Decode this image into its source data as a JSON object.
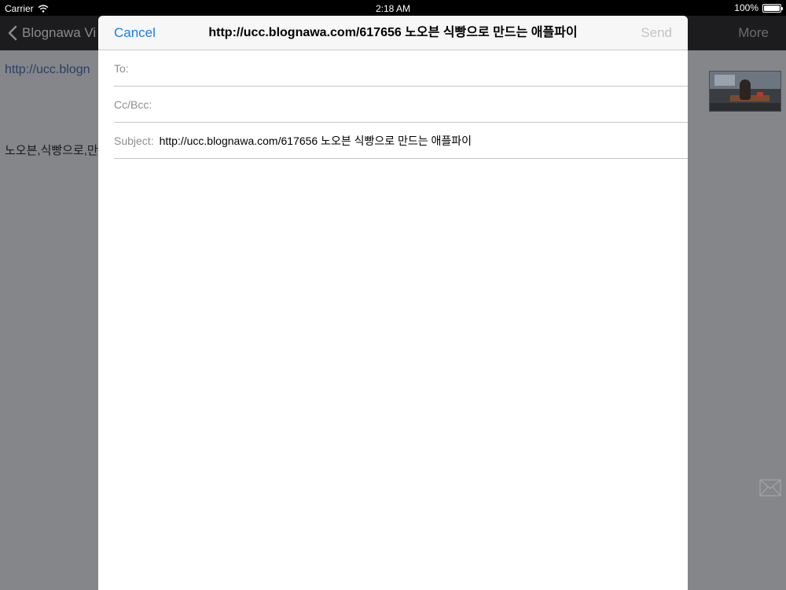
{
  "status_bar": {
    "carrier": "Carrier",
    "time": "2:18 AM",
    "battery": "100%"
  },
  "background_app": {
    "back_label": "Blognawa Vi",
    "more_label": "More",
    "url_text": "http://ucc.blogn",
    "tags_text": "노오븐,식빵으로,만"
  },
  "compose": {
    "cancel_label": "Cancel",
    "title": "http://ucc.blognawa.com/617656 노오븐 식빵으로 만드는 애플파이",
    "send_label": "Send",
    "to_label": "To:",
    "to_value": "",
    "ccbcc_label": "Cc/Bcc:",
    "ccbcc_value": "",
    "subject_label": "Subject:",
    "subject_value": "http://ucc.blognawa.com/617656 노오븐 식빵으로 만드는 애플파이",
    "body": ""
  },
  "colors": {
    "accent": "#1a7cf5",
    "disabled": "#c4c4c6",
    "label_gray": "#8e8e93",
    "dim_overlay": "#848689"
  },
  "icons": {
    "wifi": "wifi-icon",
    "battery": "battery-icon",
    "back": "chevron-left-icon",
    "mail": "mail-icon"
  }
}
